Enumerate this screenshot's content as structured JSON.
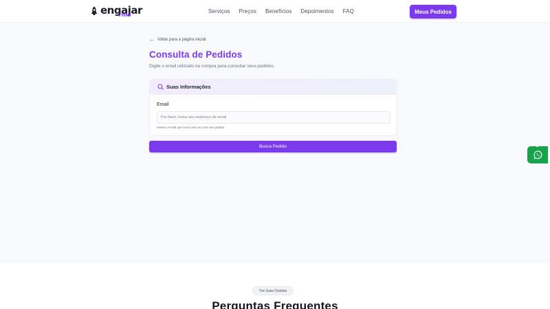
{
  "header": {
    "logo_text": "engajar",
    "logo_sub": "rma",
    "nav": [
      "Serviços",
      "Preços",
      "Benefícios",
      "Depoimentos",
      "FAQ"
    ],
    "orders_button": "Meus Pedidos"
  },
  "main": {
    "back_link": "Voltar para a página inicial",
    "title": "Consulta de Pedidos",
    "subtitle": "Digite o email utilizado na compra para consultar seus pedidos.",
    "card": {
      "heading": "Suas Informações",
      "email_label": "Email",
      "email_value": "",
      "email_placeholder": "Por favor, insira seu endereço de email",
      "hint": "mesmo e-mail que você usou ao criar seu pedido"
    },
    "search_button": "Busca Pedido"
  },
  "faq": {
    "badge": "Tire Suas Dúvidas",
    "title": "Perguntas Frequentes"
  },
  "colors": {
    "accent": "#7c3aed",
    "whatsapp": "#16a34a"
  },
  "icons": {
    "logo": "rocket-icon",
    "back": "arrow-left-icon",
    "card": "search-icon",
    "floating": "whatsapp-icon"
  }
}
